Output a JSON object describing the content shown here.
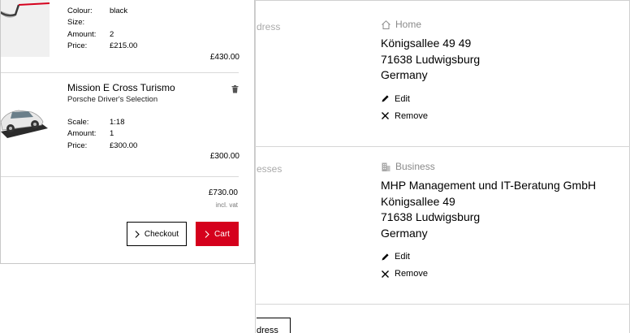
{
  "background": {
    "cut_labels": [
      "dress",
      "esses"
    ],
    "addresses": [
      {
        "type": "Home",
        "type_icon": "home-icon",
        "lines": [
          "Königsallee 49 49",
          "71638 Ludwigsburg",
          "Germany"
        ],
        "edit_label": "Edit",
        "remove_label": "Remove"
      },
      {
        "type": "Business",
        "type_icon": "building-icon",
        "lines": [
          "MHP Management und IT-Beratung GmbH",
          "Königsallee 49",
          "71638 Ludwigsburg",
          "Germany"
        ],
        "edit_label": "Edit",
        "remove_label": "Remove"
      }
    ],
    "partial_button_label": "dress"
  },
  "cart": {
    "items": [
      {
        "image": "sunglasses-thumbnail",
        "attributes": [
          {
            "key": "Colour:",
            "value": "black"
          },
          {
            "key": "Size:",
            "value": ""
          },
          {
            "key": "Amount:",
            "value": "2"
          },
          {
            "key": "Price:",
            "value": "£215.00"
          }
        ],
        "total": "£430.00"
      },
      {
        "image": "model-car-thumbnail",
        "title": "Mission E Cross Turismo",
        "subtitle": "Porsche Driver's Selection",
        "attributes": [
          {
            "key": "Scale:",
            "value": "1:18"
          },
          {
            "key": "Amount:",
            "value": "1"
          },
          {
            "key": "Price:",
            "value": "£300.00"
          }
        ],
        "total": "£300.00"
      }
    ],
    "summary_total": "£730.00",
    "vat_note": "incl. vat",
    "checkout_label": "Checkout",
    "cart_label": "Cart",
    "accent_color": "#d5001c"
  }
}
